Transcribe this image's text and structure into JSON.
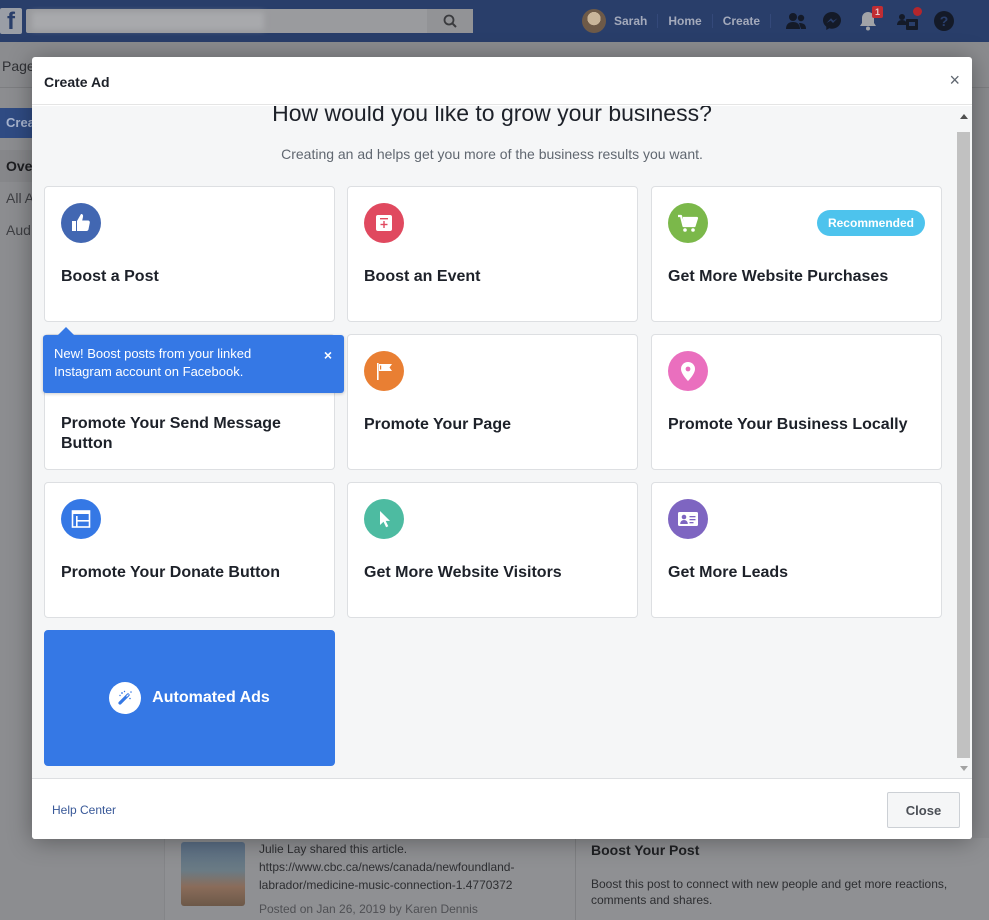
{
  "topbar": {
    "search_placeholder": "",
    "user_name": "Sarah",
    "links": [
      "Home",
      "Create"
    ],
    "notification_count": "1"
  },
  "background": {
    "subbar_label": "Page",
    "left_nav": {
      "create_button": "Crea",
      "items": [
        "Ove",
        "All A",
        "Aud"
      ]
    },
    "post": {
      "shared_text": "Julie Lay shared this article.",
      "url_line1": "https://www.cbc.ca/news/canada/newfoundland-",
      "url_line2": "labrador/medicine-music-connection-1.4770372",
      "posted": "Posted on Jan 26, 2019 by Karen Dennis"
    },
    "boost_panel": {
      "title": "Boost Your Post",
      "description": "Boost this post to connect with new people and get more reactions, comments and shares."
    }
  },
  "modal": {
    "title": "Create Ad",
    "close_icon": "×",
    "heading": "How would you like to grow your business?",
    "subheading": "Creating an ad helps get you more of the business results you want.",
    "cards": [
      {
        "label": "Boost a Post",
        "icon": "thumbs-up-icon",
        "color": "#4267b2"
      },
      {
        "label": "Boost an Event",
        "icon": "calendar-plus-icon",
        "color": "#e0495f"
      },
      {
        "label": "Get More Website Purchases",
        "icon": "shopping-cart-icon",
        "color": "#7bb84a",
        "badge": "Recommended"
      },
      {
        "label": "Promote Your Send Message Button",
        "icon": "messenger-icon",
        "color": "#0084ff"
      },
      {
        "label": "Promote Your Page",
        "icon": "flag-icon",
        "color": "#e97f33"
      },
      {
        "label": "Promote Your Business Locally",
        "icon": "location-pin-icon",
        "color": "#ea6fbe"
      },
      {
        "label": "Promote Your Donate Button",
        "icon": "browser-window-icon",
        "color": "#3578e5"
      },
      {
        "label": "Get More Website Visitors",
        "icon": "cursor-icon",
        "color": "#4dbba1"
      },
      {
        "label": "Get More Leads",
        "icon": "contact-card-icon",
        "color": "#7e65c1"
      }
    ],
    "automated_ads": {
      "label": "Automated Ads",
      "icon": "magic-wand-icon",
      "color": "#3578e5"
    },
    "tooltip": {
      "text": "New! Boost posts from your linked Instagram account on Facebook.",
      "close_icon": "×"
    },
    "footer": {
      "help_link": "Help Center",
      "close_button": "Close"
    }
  }
}
